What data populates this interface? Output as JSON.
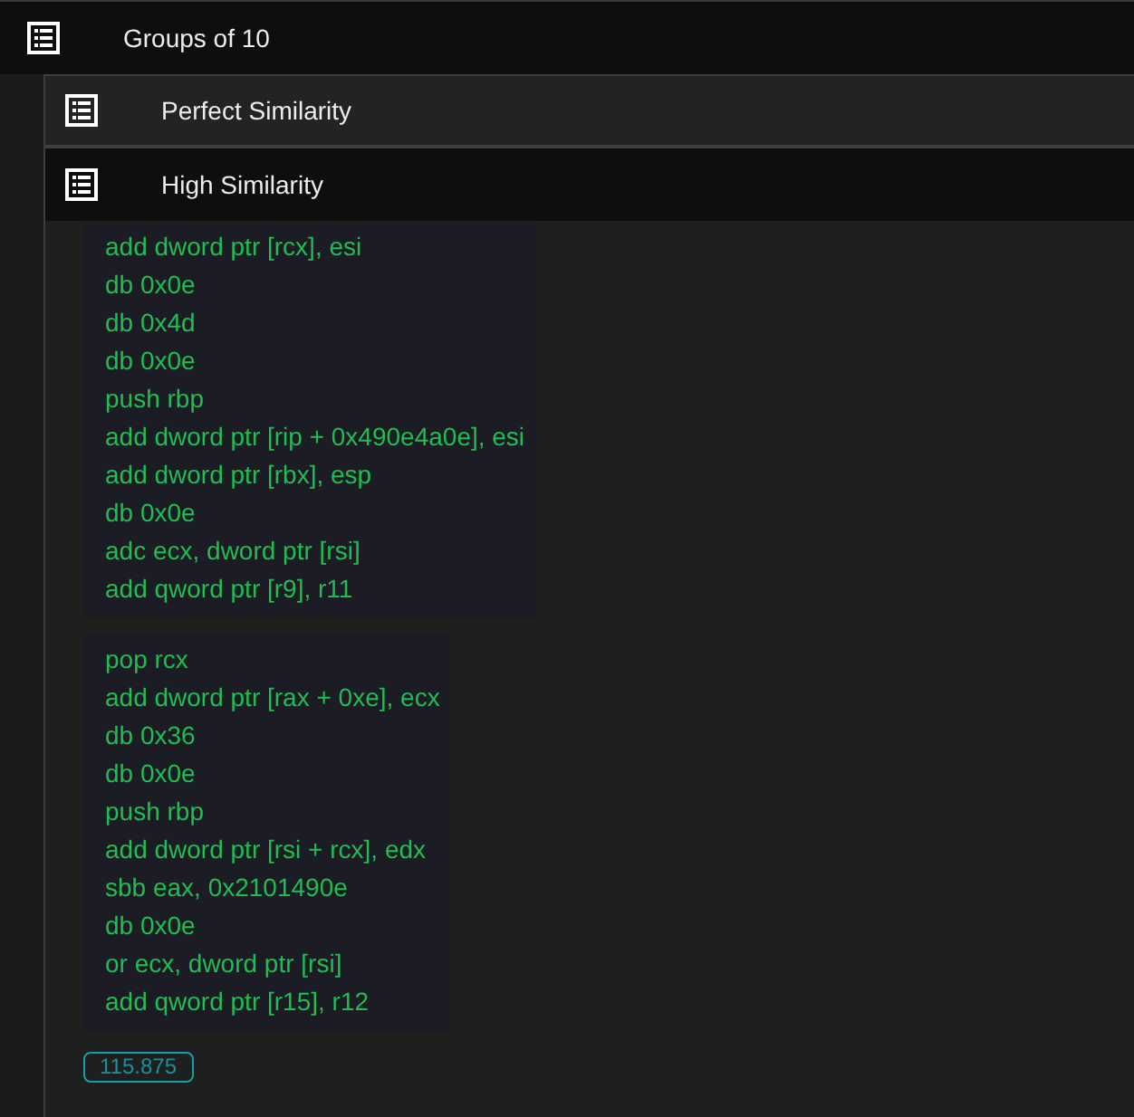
{
  "group": {
    "title": "Groups of 10"
  },
  "sections": [
    {
      "title": "Perfect Similarity",
      "expanded": false
    },
    {
      "title": "High Similarity",
      "expanded": true,
      "blocks": [
        {
          "lines": [
            "add dword ptr [rcx], esi",
            "db 0x0e",
            "db 0x4d",
            "db 0x0e",
            "push rbp",
            "add dword ptr [rip + 0x490e4a0e], esi",
            "add dword ptr [rbx], esp",
            "db 0x0e",
            "adc ecx, dword ptr [rsi]",
            "add qword ptr [r9], r11"
          ]
        },
        {
          "lines": [
            "pop rcx",
            "add dword ptr [rax + 0xe], ecx",
            "db 0x36",
            "db 0x0e",
            "push rbp",
            "add dword ptr [rsi + rcx], edx",
            "sbb eax, 0x2101490e",
            "db 0x0e",
            "or ecx, dword ptr [rsi]",
            "add qword ptr [r15], r12"
          ]
        }
      ],
      "score": "115.875"
    }
  ]
}
